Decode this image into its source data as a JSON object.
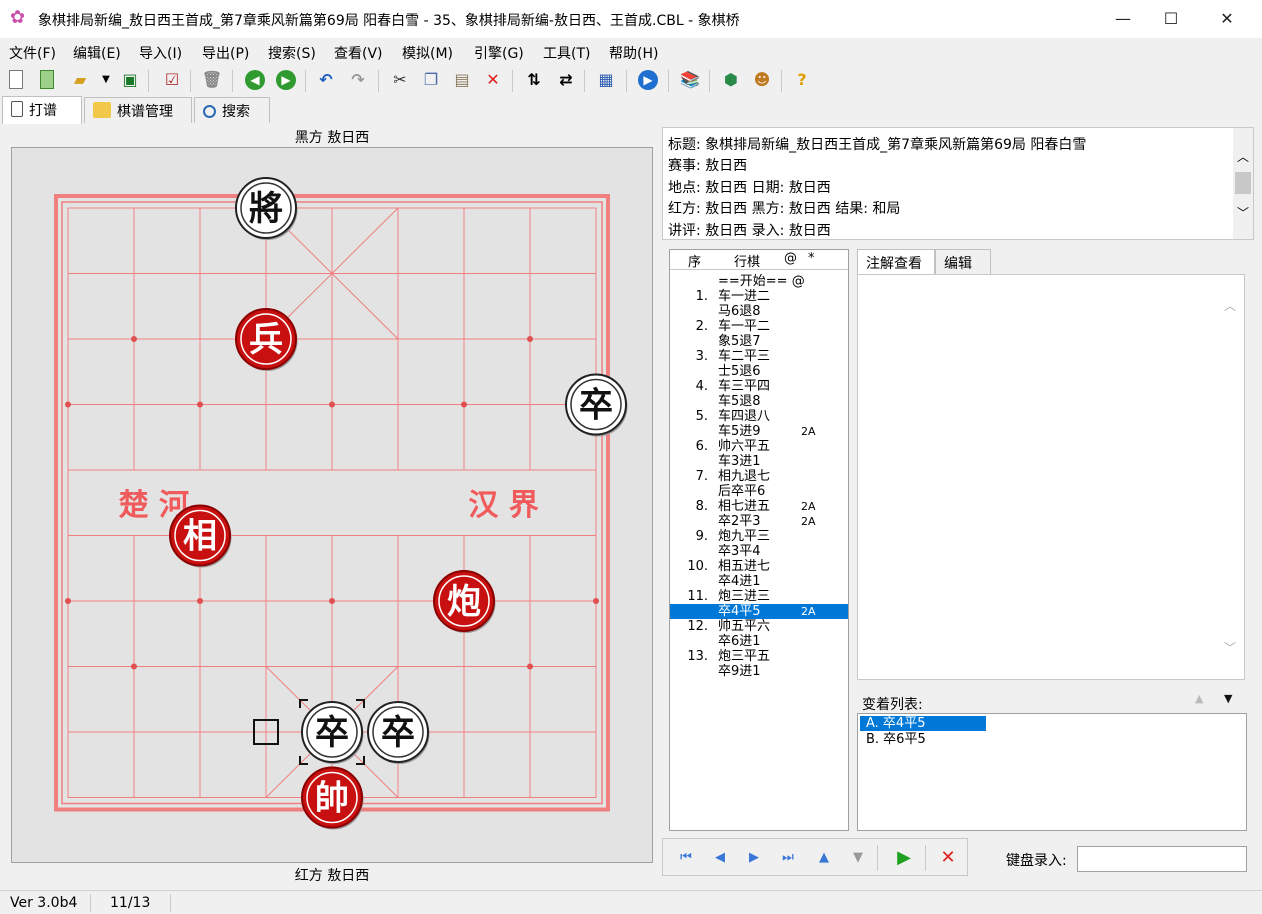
{
  "window": {
    "title": "象棋排局新编_敖日西王首成_第7章乘风新篇第69局 阳春白雪 - 35、象棋排局新编-敖日西、王首成.CBL - 象棋桥",
    "minimize": "—",
    "maximize": "☐",
    "close": "✕"
  },
  "menu": [
    "文件(F)",
    "编辑(E)",
    "导入(I)",
    "导出(P)",
    "搜索(S)",
    "查看(V)",
    "模拟(M)",
    "引擎(G)",
    "工具(T)",
    "帮助(H)"
  ],
  "tabs": [
    "打谱",
    "棋谱管理",
    "搜索"
  ],
  "board": {
    "top_label": "黑方 敖日西",
    "bottom_label": "红方 敖日西",
    "river_left": "楚 河",
    "river_right": "汉 界",
    "pieces": [
      {
        "char": "將",
        "side": "black",
        "file": 3,
        "rank": 0
      },
      {
        "char": "兵",
        "side": "red",
        "file": 3,
        "rank": 2
      },
      {
        "char": "卒",
        "side": "black",
        "file": 8,
        "rank": 3
      },
      {
        "char": "相",
        "side": "red",
        "file": 2,
        "rank": 5
      },
      {
        "char": "炮",
        "side": "red",
        "file": 6,
        "rank": 6
      },
      {
        "char": "卒",
        "side": "black",
        "file": 4,
        "rank": 8
      },
      {
        "char": "卒",
        "side": "black",
        "file": 5,
        "rank": 8
      },
      {
        "char": "帥",
        "side": "red",
        "file": 4,
        "rank": 9
      }
    ],
    "selected": {
      "file": 4,
      "rank": 8
    },
    "last_from": {
      "file": 3,
      "rank": 8
    }
  },
  "info": {
    "title": "标题:  象棋排局新编_敖日西王首成_第7章乘风新篇第69局 阳春白雪",
    "event": "赛事: 敖日西",
    "place_date": "地点: 敖日西   日期: 敖日西",
    "players_result": "红方: 敖日西   黑方: 敖日西   结果: 和局",
    "commentary": "讲评: 敖日西   录入: 敖日西"
  },
  "movelist": {
    "headers": [
      "序",
      "行棋",
      "@",
      "*"
    ],
    "rows": [
      {
        "n": "",
        "t": "==开始== @",
        "v": ""
      },
      {
        "n": "1.",
        "t": "车一进二",
        "v": ""
      },
      {
        "n": "",
        "t": "马6退8",
        "v": ""
      },
      {
        "n": "2.",
        "t": "车一平二",
        "v": ""
      },
      {
        "n": "",
        "t": "象5退7",
        "v": ""
      },
      {
        "n": "3.",
        "t": "车二平三",
        "v": ""
      },
      {
        "n": "",
        "t": "士5退6",
        "v": ""
      },
      {
        "n": "4.",
        "t": "车三平四",
        "v": ""
      },
      {
        "n": "",
        "t": "车5退8",
        "v": ""
      },
      {
        "n": "5.",
        "t": "车四退八",
        "v": ""
      },
      {
        "n": "",
        "t": "车5进9",
        "v": "2A"
      },
      {
        "n": "6.",
        "t": "帅六平五",
        "v": ""
      },
      {
        "n": "",
        "t": "车3进1",
        "v": ""
      },
      {
        "n": "7.",
        "t": "相九退七",
        "v": ""
      },
      {
        "n": "",
        "t": "后卒平6",
        "v": ""
      },
      {
        "n": "8.",
        "t": "相七进五",
        "v": "2A"
      },
      {
        "n": "",
        "t": "卒2平3",
        "v": "2A"
      },
      {
        "n": "9.",
        "t": "炮九平三",
        "v": ""
      },
      {
        "n": "",
        "t": "卒3平4",
        "v": ""
      },
      {
        "n": "10.",
        "t": "相五进七",
        "v": ""
      },
      {
        "n": "",
        "t": "卒4进1",
        "v": ""
      },
      {
        "n": "11.",
        "t": "炮三进三",
        "v": ""
      },
      {
        "n": "",
        "t": "卒4平5",
        "v": "2A"
      },
      {
        "n": "12.",
        "t": "帅五平六",
        "v": ""
      },
      {
        "n": "",
        "t": "卒6进1",
        "v": ""
      },
      {
        "n": "13.",
        "t": "炮三平五",
        "v": ""
      },
      {
        "n": "",
        "t": "卒9进1",
        "v": ""
      }
    ],
    "selected_index": 22
  },
  "notes": {
    "tabs": [
      "注解查看",
      "编辑"
    ],
    "variations_label": "变着列表:",
    "variations": [
      "A. 卒4平5",
      "B. 卒6平5"
    ]
  },
  "keyboard_label": "键盘录入:",
  "keyboard_value": "",
  "status": {
    "version": "Ver 3.0b4",
    "progress": "11/13"
  },
  "colors": {
    "board_line": "#f08080",
    "red_piece": "#c81010",
    "black_piece": "#111111",
    "selection": "#0078d7"
  }
}
